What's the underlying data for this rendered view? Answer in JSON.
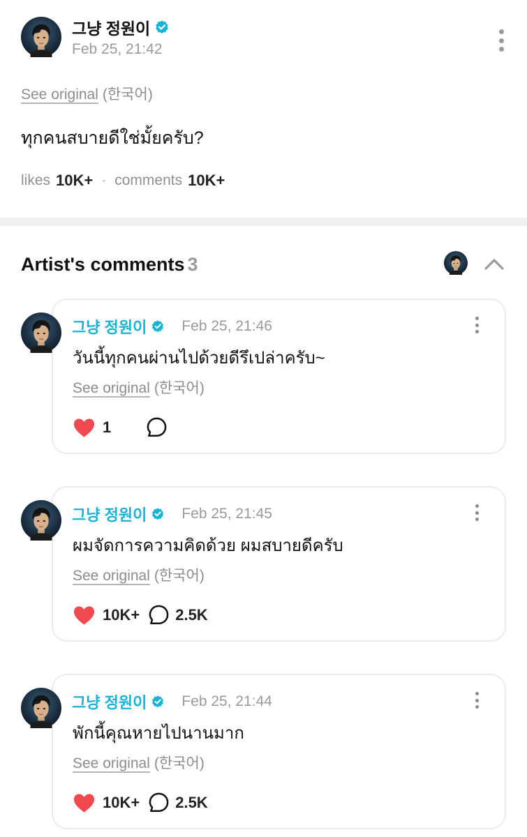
{
  "post": {
    "author": "그냥 정원이",
    "time": "Feb 25, 21:42",
    "see_original": "See original",
    "original_lang": "(한국어)",
    "body": "ทุกคนสบายดีใช่มั้ยครับ?",
    "likes_label": "likes",
    "likes_value": "10K+",
    "separator": "·",
    "comments_label": "comments",
    "comments_value": "10K+"
  },
  "section": {
    "title": "Artist's comments",
    "count": "3"
  },
  "comments": [
    {
      "author": "그냥 정원이",
      "time": "Feb 25, 21:46",
      "body": "วันนี้ทุกคนผ่านไปด้วยดีรึเปล่าครับ~",
      "see_original": "See original",
      "original_lang": "(한국어)",
      "likes": "1",
      "replies": ""
    },
    {
      "author": "그냥 정원이",
      "time": "Feb 25, 21:45",
      "body": "ผมจัดการความคิดด้วย ผมสบายดีครับ",
      "see_original": "See original",
      "original_lang": "(한국어)",
      "likes": "10K+",
      "replies": "2.5K"
    },
    {
      "author": "그냥 정원이",
      "time": "Feb 25, 21:44",
      "body": "พักนี้คุณหายไปนานมาก",
      "see_original": "See original",
      "original_lang": "(한국어)",
      "likes": "10K+",
      "replies": "2.5K"
    }
  ],
  "icons": {
    "verified": "verified-badge-icon",
    "more": "more-vertical-icon",
    "heart": "heart-icon",
    "reply": "speech-bubble-icon",
    "collapse": "chevron-up-icon"
  },
  "colors": {
    "verified": "#17b3d6",
    "author_name": "#17b3d6",
    "heart": "#f1494f",
    "muted_text": "#9a9a9a",
    "divider": "#f1f1f3",
    "card_border": "#ececf0"
  }
}
